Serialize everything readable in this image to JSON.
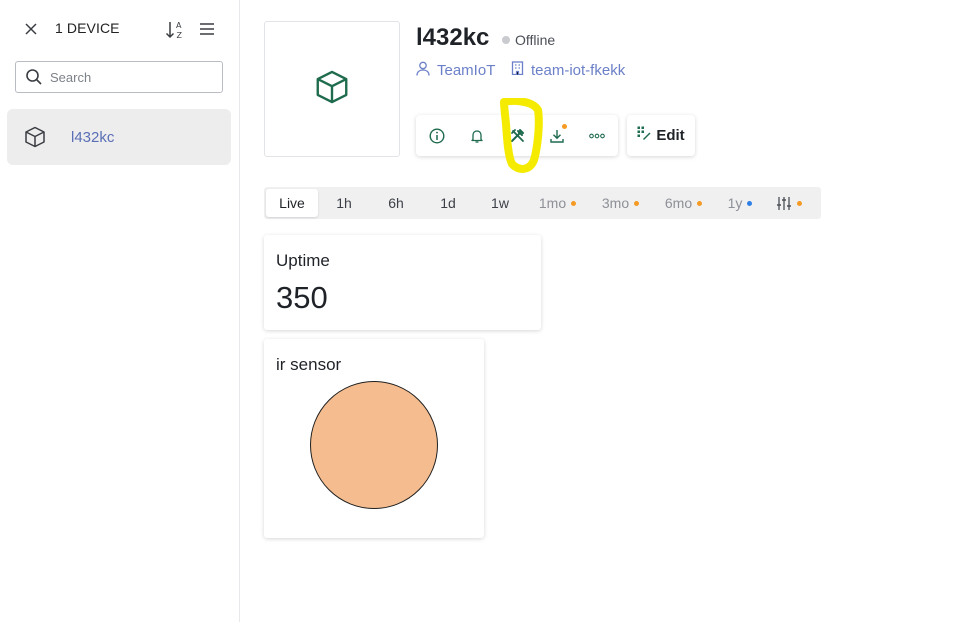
{
  "sidebar": {
    "device_count": "1 DEVICE",
    "search_placeholder": "Search",
    "items": [
      {
        "label": "l432kc",
        "icon": "cube-icon",
        "selected": true
      }
    ]
  },
  "device": {
    "name": "l432kc",
    "status": "Offline",
    "status_color": "#c9cbcf",
    "owner": "TeamIoT",
    "team": "team-iot-fkekk",
    "accent": "#1f6b4e",
    "link_color": "#6b80c8"
  },
  "toolbar": {
    "buttons": [
      {
        "icon": "info-icon"
      },
      {
        "icon": "bell-icon"
      },
      {
        "icon": "tools-icon"
      },
      {
        "icon": "download-icon",
        "badge_color": "#f59a23"
      },
      {
        "icon": "more-icon"
      }
    ],
    "edit_label": "Edit"
  },
  "time_ranges": [
    {
      "label": "Live",
      "active": true
    },
    {
      "label": "1h"
    },
    {
      "label": "6h"
    },
    {
      "label": "1d"
    },
    {
      "label": "1w"
    },
    {
      "label": "1mo",
      "dot": "#f59a23"
    },
    {
      "label": "3mo",
      "dot": "#f59a23"
    },
    {
      "label": "6mo",
      "dot": "#f59a23"
    },
    {
      "label": "1y",
      "dot": "#2f7fe6"
    },
    {
      "icon": "sliders-icon",
      "dot": "#f59a23"
    }
  ],
  "widgets": {
    "uptime": {
      "title": "Uptime",
      "value": "350"
    },
    "ir_sensor": {
      "title": "ir sensor",
      "led_color": "#f5bd8f"
    }
  },
  "annotation_color": "#f5eb00"
}
